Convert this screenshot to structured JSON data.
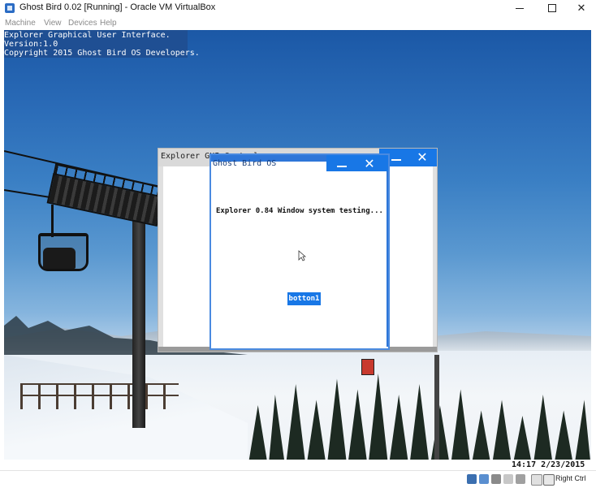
{
  "vbox": {
    "window_title": "Ghost Bird 0.02 [Running] - Oracle VM VirtualBox",
    "menu": [
      "Machine",
      "View",
      "Devices",
      "Help"
    ],
    "controls": {
      "minimize": "minimize-icon",
      "maximize": "maximize-icon",
      "close": "close-icon"
    },
    "status_right_label": "Right Ctrl"
  },
  "guest": {
    "banner_lines": [
      "Explorer Graphical User Interface.",
      "Version:1.0",
      "Copyright 2015 Ghost Bird OS Developers."
    ],
    "explorer_window": {
      "title": "Explorer GUI Control"
    },
    "ghost_window": {
      "title": "Ghost Bird OS",
      "minimize_glyph": "_",
      "close_glyph": "✕",
      "message": "Explorer 0.84 Window system testing...",
      "button_label": "botton1"
    },
    "explorer_controls": {
      "minimize_glyph": "_",
      "close_glyph": "✕"
    },
    "clock": "14:17 2/23/2015"
  },
  "colors": {
    "accent_blue": "#1877e6",
    "title_blue": "#2e76d8",
    "banner_blue": "#1f4f93"
  }
}
